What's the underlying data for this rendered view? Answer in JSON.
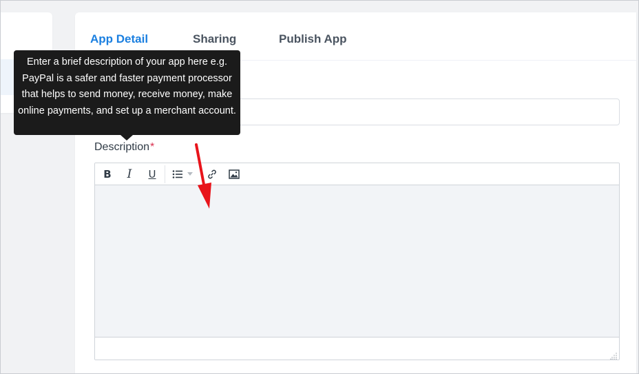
{
  "tabs": [
    {
      "label": "App Detail",
      "active": true
    },
    {
      "label": "Sharing",
      "active": false
    },
    {
      "label": "Publish App",
      "active": false
    }
  ],
  "form": {
    "name_value": "",
    "description_label": "Description",
    "required_marker": "*",
    "description_value": ""
  },
  "toolbar": {
    "bold_glyph": "B",
    "italic_glyph": "I",
    "underline_glyph": "U",
    "icons": [
      "bold-icon",
      "italic-icon",
      "underline-icon",
      "bullet-list-icon",
      "caret-down-icon",
      "link-icon",
      "image-icon"
    ]
  },
  "tooltip": {
    "text": "Enter a brief description of your app here e.g. PayPal is a safer and faster payment processor that helps to send money, receive money, make online payments, and set up a merchant account."
  },
  "colors": {
    "active_tab": "#1a7fe0",
    "tooltip_bg": "#1b1b1b",
    "required": "#d9304f",
    "annotation_arrow": "#e8141b",
    "editor_bg": "#f2f4f7"
  }
}
